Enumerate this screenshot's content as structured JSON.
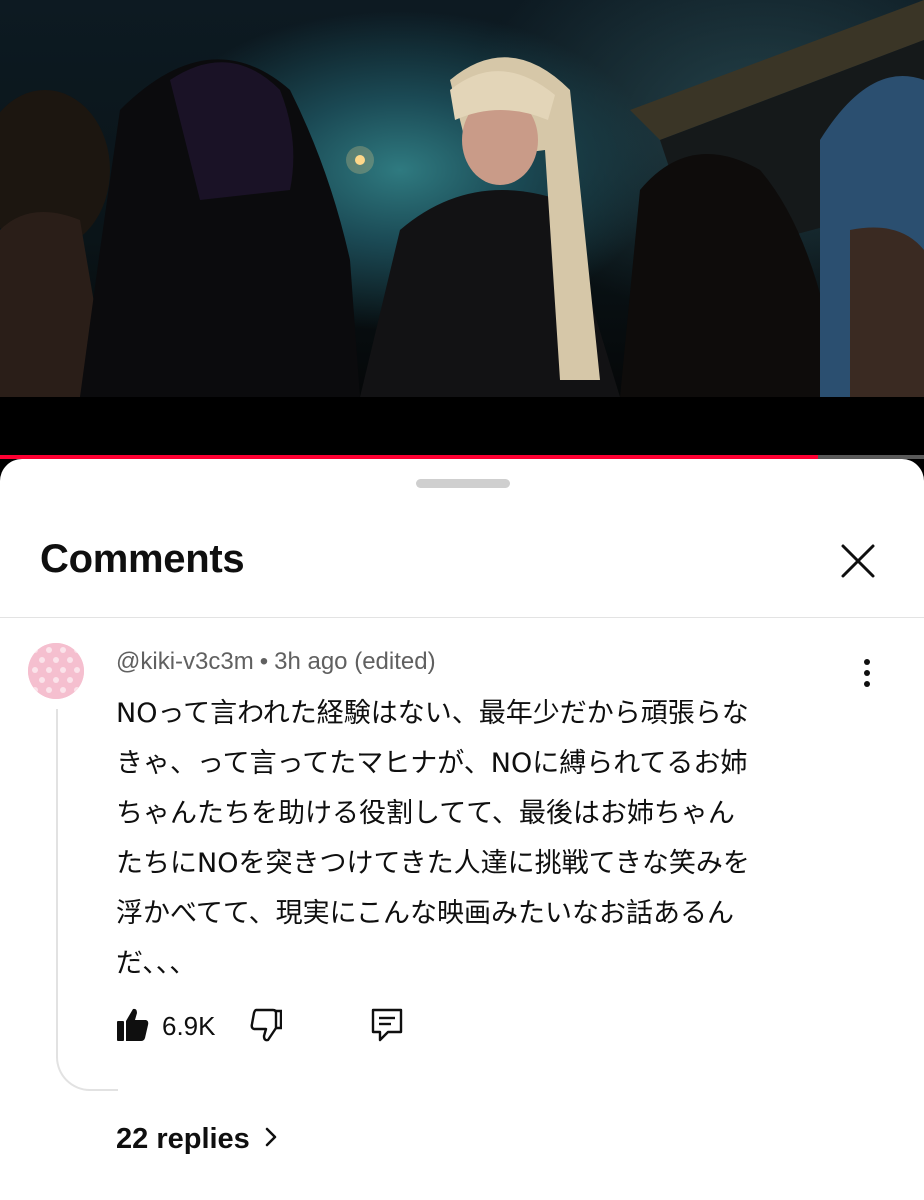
{
  "video": {
    "progress_fraction": 0.885,
    "accent_color": "#ff0033"
  },
  "comments_panel": {
    "title": "Comments",
    "close_icon": "close-icon"
  },
  "comment": {
    "author": "@kiki-v3c3m",
    "separator": "•",
    "time": "3h ago",
    "edited": "(edited)",
    "text": "NOって言われた経験はない、最年少だから頑張らな\nきゃ、って言ってたマヒナが、NOに縛られてるお姉\nちゃんたちを助ける役割してて、最後はお姉ちゃん\nたちにNOを突きつけてきた人達に挑戦てきな笑みを\n浮かべてて、現実にこんな映画みたいなお話あるん\nだ、、、",
    "like_count": "6.9K",
    "replies_label": "22 replies",
    "icons": {
      "like": "thumbs-up-icon",
      "dislike": "thumbs-down-icon",
      "reply": "reply-icon",
      "more": "more-vertical-icon",
      "chevron": "chevron-right-icon"
    }
  }
}
